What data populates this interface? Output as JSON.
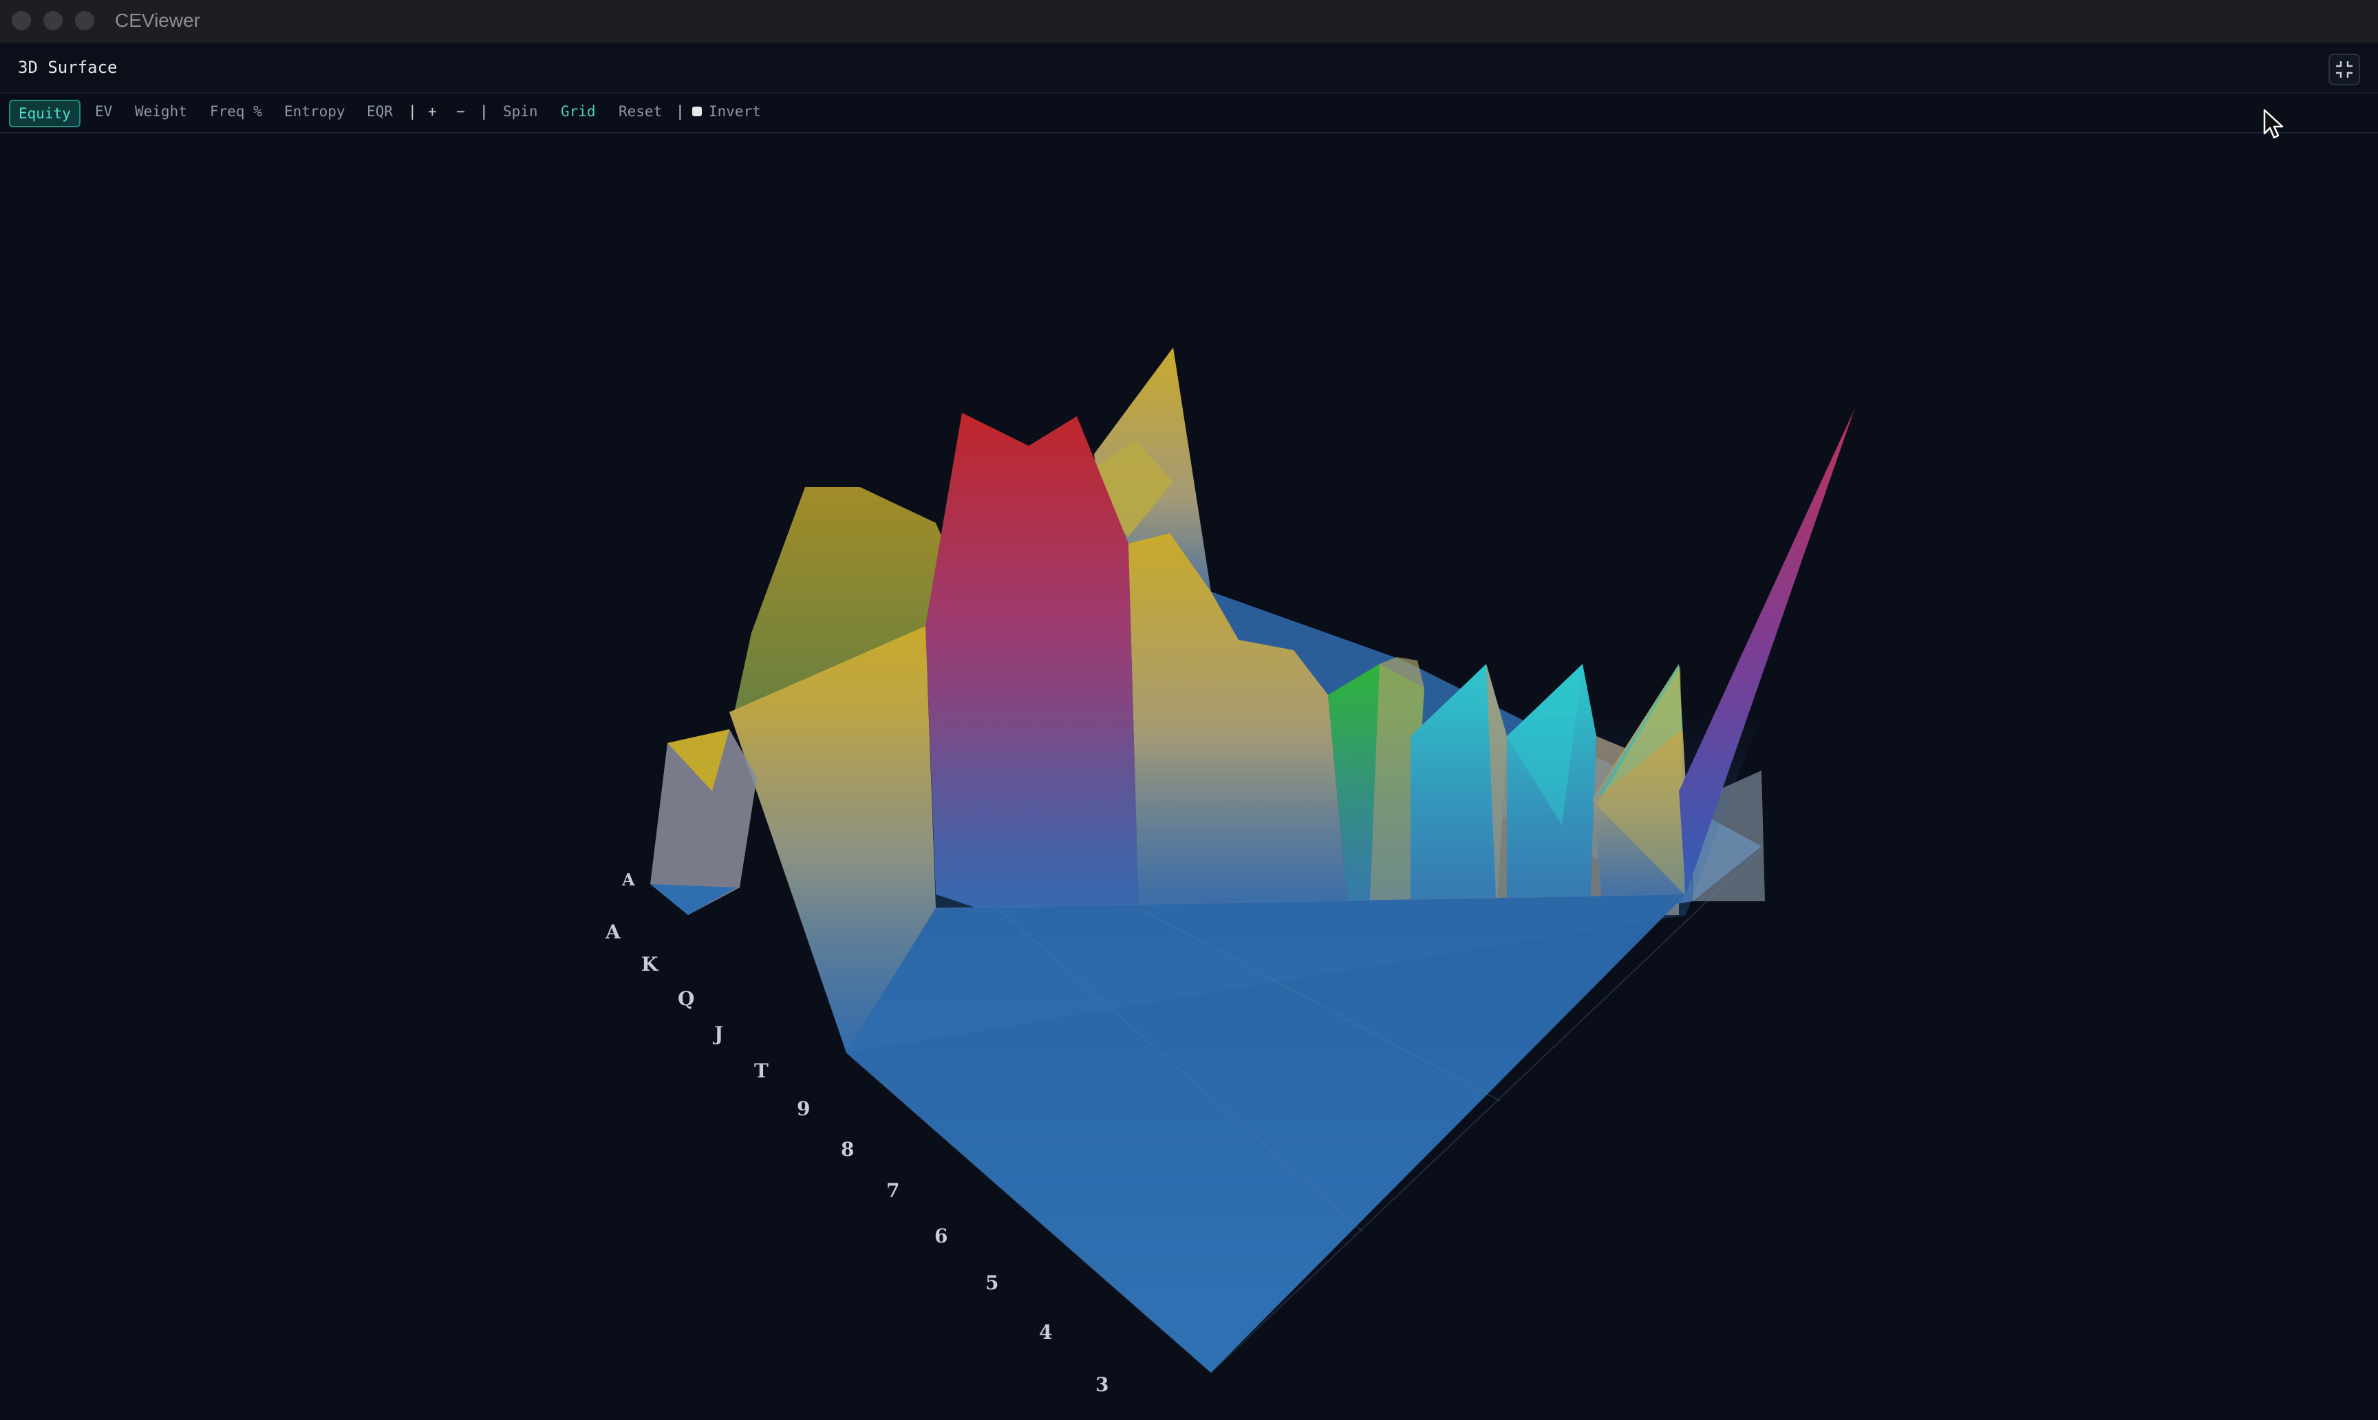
{
  "window": {
    "title": "CEViewer"
  },
  "panel": {
    "title": "3D Surface"
  },
  "toolbar": {
    "modes": [
      "Equity",
      "EV",
      "Weight",
      "Freq %",
      "Entropy",
      "EQR"
    ],
    "active_mode": "Equity",
    "zoom_in": "+",
    "zoom_out": "−",
    "separator": "|",
    "spin": "Spin",
    "grid": "Grid",
    "reset": "Reset",
    "invert": "Invert",
    "invert_checked": false
  },
  "axis": {
    "row_labels": [
      "A",
      "K",
      "Q",
      "J",
      "T",
      "9",
      "8",
      "7",
      "6",
      "5",
      "4",
      "3"
    ],
    "top_label": "A"
  },
  "colors": {
    "accent": "#4fe0cf",
    "surface_base": "#2f6fb0",
    "background": "#0a0e19"
  },
  "icons": {
    "fullscreen": "collapse-fullscreen-icon",
    "cursor": "pointer-cursor-icon"
  }
}
